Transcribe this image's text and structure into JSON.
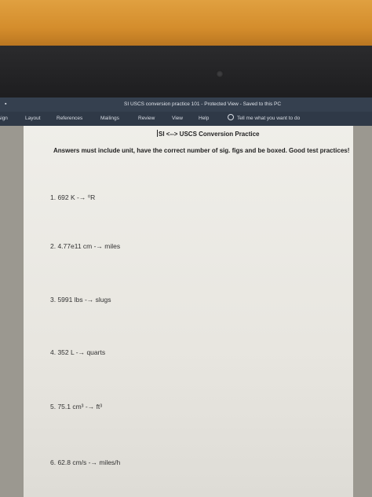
{
  "window": {
    "title": "SI USCS conversion practice 101  -  Protected View  -  Saved to this PC"
  },
  "ribbon": {
    "tabs": [
      "sign",
      "Layout",
      "References",
      "Mailings",
      "Review",
      "View",
      "Help"
    ],
    "tell_me": "Tell me what you want to do"
  },
  "document": {
    "heading": "SI <--> USCS Conversion Practice",
    "instructions": "Answers must include unit, have the correct number of sig. figs and be boxed.  Good test practices!",
    "problems": [
      "1.  692 K -→ ⁰R",
      "2.  4.77e11 cm -→ miles",
      "3.  5991 lbs -→  slugs",
      "4.  352 L -→ quarts",
      "5.  75.1 cm³ -→ ft³",
      "6.  62.8 cm/s -→  miles/h"
    ]
  }
}
